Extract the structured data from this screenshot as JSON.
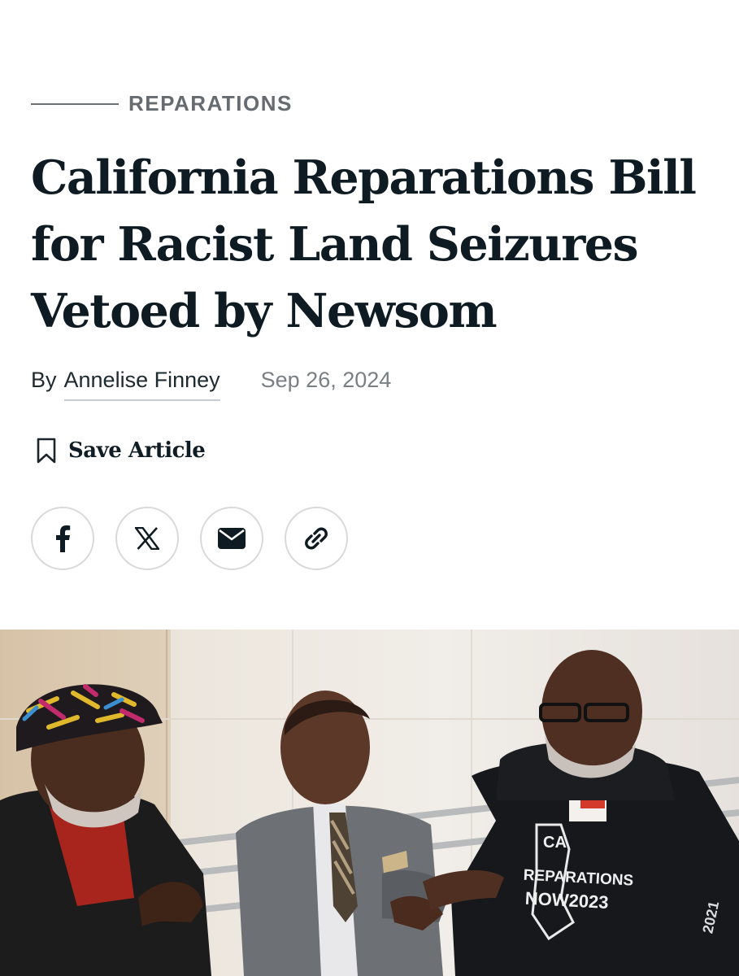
{
  "article": {
    "category": "REPARATIONS",
    "headline_lines": [
      "California Reparations Bill",
      "for Racist Land Seizures",
      "Vetoed by Newsom"
    ],
    "byline_prefix": "By",
    "author": "Annelise Finney",
    "date": "Sep 26, 2024",
    "save_label": "Save Article"
  },
  "share": {
    "icons": [
      "facebook-icon",
      "x-icon",
      "email-icon",
      "link-icon"
    ]
  },
  "photo": {
    "cap_text": "",
    "shirt_text_lines": [
      "CA",
      "REPARATIONS",
      "NOW2023"
    ],
    "sleeve_text": "2021"
  },
  "colors": {
    "headline": "#0f1b22",
    "category": "#666b70",
    "date": "#7a7f83",
    "circle_border": "#d7d9db"
  }
}
